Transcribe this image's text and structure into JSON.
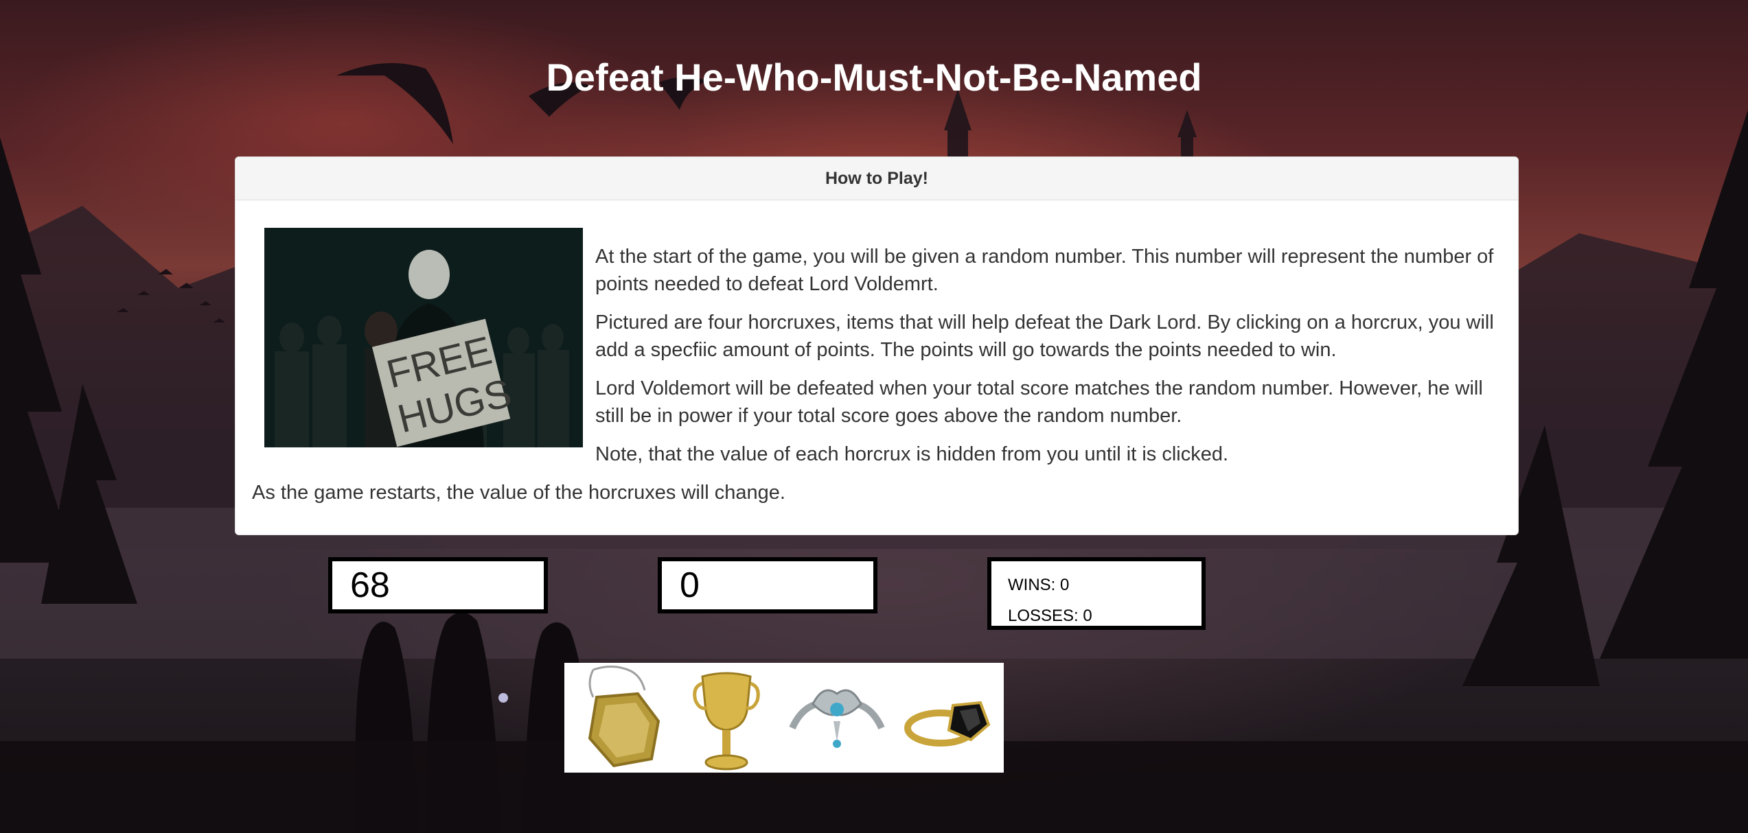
{
  "title": "Defeat He-Who-Must-Not-Be-Named",
  "instructions": {
    "heading": "How to Play!",
    "paragraphs": [
      "At the start of the game, you will be given a random number. This number will represent the number of points needed to defeat Lord Voldemrt.",
      "Pictured are four horcruxes, items that will help defeat the Dark Lord. By clicking on a horcrux, you will add a specfiic amount of points. The points will go towards the points needed to win.",
      "Lord Voldemort will be defeated when your total score matches the random number. However, he will still be in power if your total score goes above the random number.",
      "Note, that the value of each horcrux is hidden from you until it is clicked.",
      "As the game restarts, the value of the horcruxes will change."
    ],
    "photo_sign_line1": "FREE",
    "photo_sign_line2": "HUGS"
  },
  "game": {
    "target_number": "68",
    "total_score": "0",
    "wins": "WINS: 0",
    "losses": "LOSSES: 0"
  },
  "horcruxes": [
    {
      "icon": "locket-icon"
    },
    {
      "icon": "cup-icon"
    },
    {
      "icon": "diadem-icon"
    },
    {
      "icon": "ring-icon"
    }
  ],
  "colors": {
    "box_border": "#000000",
    "panel_heading_bg": "#f5f5f5",
    "title_text": "#ffffff"
  }
}
